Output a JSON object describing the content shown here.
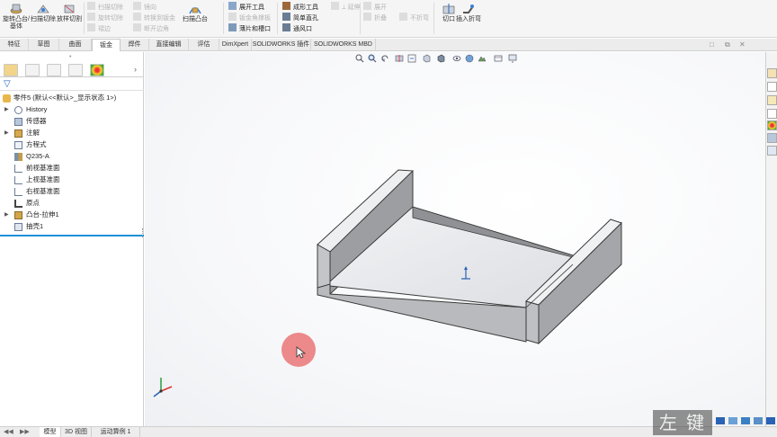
{
  "ribbon": {
    "big_buttons": [
      {
        "label": "旋转凸台/基体",
        "icon": "revolve-boss-icon"
      },
      {
        "label": "扫描切除",
        "icon": "swept-cut-icon"
      },
      {
        "label": "放样切割",
        "icon": "loft-cut-icon"
      },
      {
        "label": "扫描凸台",
        "icon": "sweep-icon"
      },
      {
        "label": "切口",
        "icon": "cut-icon"
      },
      {
        "label": "插入折弯",
        "icon": "insert-bends-icon"
      }
    ],
    "rows": [
      {
        "label": "扫描切除",
        "dim": true
      },
      {
        "label": "旋转切除",
        "dim": true
      },
      {
        "label": "褶边",
        "dim": true
      },
      {
        "label": "镜向",
        "dim": true
      },
      {
        "label": "转换到钣金",
        "dim": true
      },
      {
        "label": "断开边角",
        "dim": true
      },
      {
        "label": "展开工具",
        "dim": false
      },
      {
        "label": "钣金角撑板",
        "dim": true
      },
      {
        "label": "薄片和槽口",
        "dim": false
      },
      {
        "label": "成形工具",
        "dim": false
      },
      {
        "label": "简单直孔",
        "dim": false
      },
      {
        "label": "通风口",
        "dim": false
      },
      {
        "label": "展开",
        "dim": true
      },
      {
        "label": "折叠",
        "dim": true
      },
      {
        "label": "不折弯",
        "dim": true
      }
    ]
  },
  "tabs": [
    "特征",
    "草图",
    "曲面",
    "钣金",
    "焊件",
    "直接编辑",
    "评估",
    "DimXpert",
    "SOLIDWORKS 插件",
    "SOLIDWORKS MBD"
  ],
  "active_tab": "钣金",
  "window_controls": [
    "□",
    "⧉",
    "✕"
  ],
  "feature_tree": {
    "root": "零件5 (默认<<默认>_显示状态 1>)",
    "items": [
      {
        "label": "History",
        "icon": "history-icon",
        "expandable": true
      },
      {
        "label": "传感器",
        "icon": "sensor-icon",
        "expandable": false
      },
      {
        "label": "注解",
        "icon": "annotation-icon",
        "expandable": true
      },
      {
        "label": "方程式",
        "icon": "equation-icon",
        "expandable": false
      },
      {
        "label": "Q235-A",
        "icon": "material-icon",
        "expandable": false
      },
      {
        "label": "前视基准面",
        "icon": "plane-icon",
        "expandable": false
      },
      {
        "label": "上视基准面",
        "icon": "plane-icon",
        "expandable": false
      },
      {
        "label": "右视基准面",
        "icon": "plane-icon",
        "expandable": false
      },
      {
        "label": "原点",
        "icon": "origin-icon",
        "expandable": false
      },
      {
        "label": "凸台-拉伸1",
        "icon": "extrude-icon",
        "expandable": true
      },
      {
        "label": "抽壳1",
        "icon": "shell-icon",
        "expandable": false
      }
    ]
  },
  "bottom_tabs": [
    "模型",
    "3D 视图",
    "运动算例 1"
  ],
  "active_bottom_tab": "模型",
  "watermark": "左 键",
  "colors": {
    "accent": "#1e8fd6",
    "part_face": "#c9cacd",
    "part_top": "#eeeff1",
    "part_edge": "#3a3a3a",
    "cursor_marker": "#e86464"
  }
}
